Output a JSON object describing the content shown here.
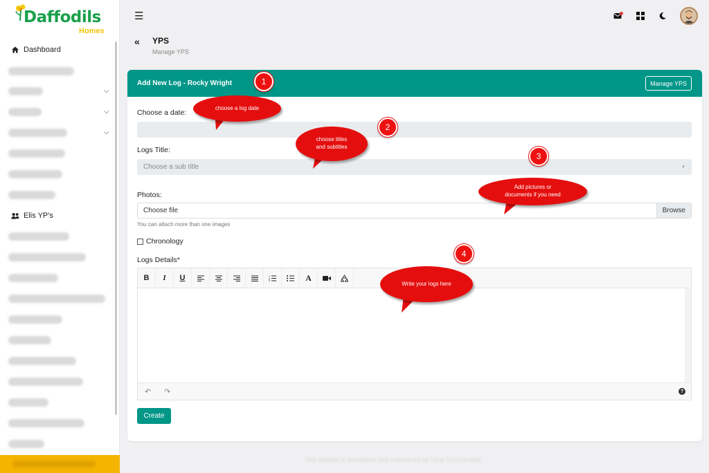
{
  "brand": {
    "name": "Daffodils",
    "sub": "Homes"
  },
  "sidebar": {
    "dashboard": "Dashboard",
    "yps": "Elis YP's"
  },
  "header": {
    "title": "YPS",
    "subtitle": "Manage YPS"
  },
  "card": {
    "title": "Add New Log - Rocky Wright",
    "manage_button": "Manage YPS"
  },
  "form": {
    "date_label": "Choose a date:",
    "title_label": "Logs Title:",
    "title_placeholder": "Choose a sub title",
    "photos_label": "Photos:",
    "file_placeholder": "Choose file",
    "browse_label": "Browse",
    "photos_hint": "You can attach more than one images",
    "chronology_label": "Chronology",
    "details_label": "Logs Details*",
    "create_button": "Create"
  },
  "editor_toolbar": [
    "B",
    "I",
    "U",
    "align-left",
    "align-center",
    "align-right",
    "justify",
    "ordered-list",
    "unordered-list",
    "A",
    "video",
    "recycle"
  ],
  "annotations": {
    "badges": [
      "1",
      "2",
      "3",
      "4"
    ],
    "bubble1": "choose a log date",
    "bubble2_line1": "choose titles",
    "bubble2_line2": "and subtitles",
    "bubble3_line1": "Add pictures or",
    "bubble3_line2": "documents if you need",
    "bubble4": "Write your logs here"
  },
  "colors": {
    "primary": "#009688",
    "annotation": "#e50e0e",
    "logo_green": "#19a04b",
    "logo_yellow": "#f2c40a"
  },
  "footer": "This website is developed and maintained by Vlink Tech Limited"
}
